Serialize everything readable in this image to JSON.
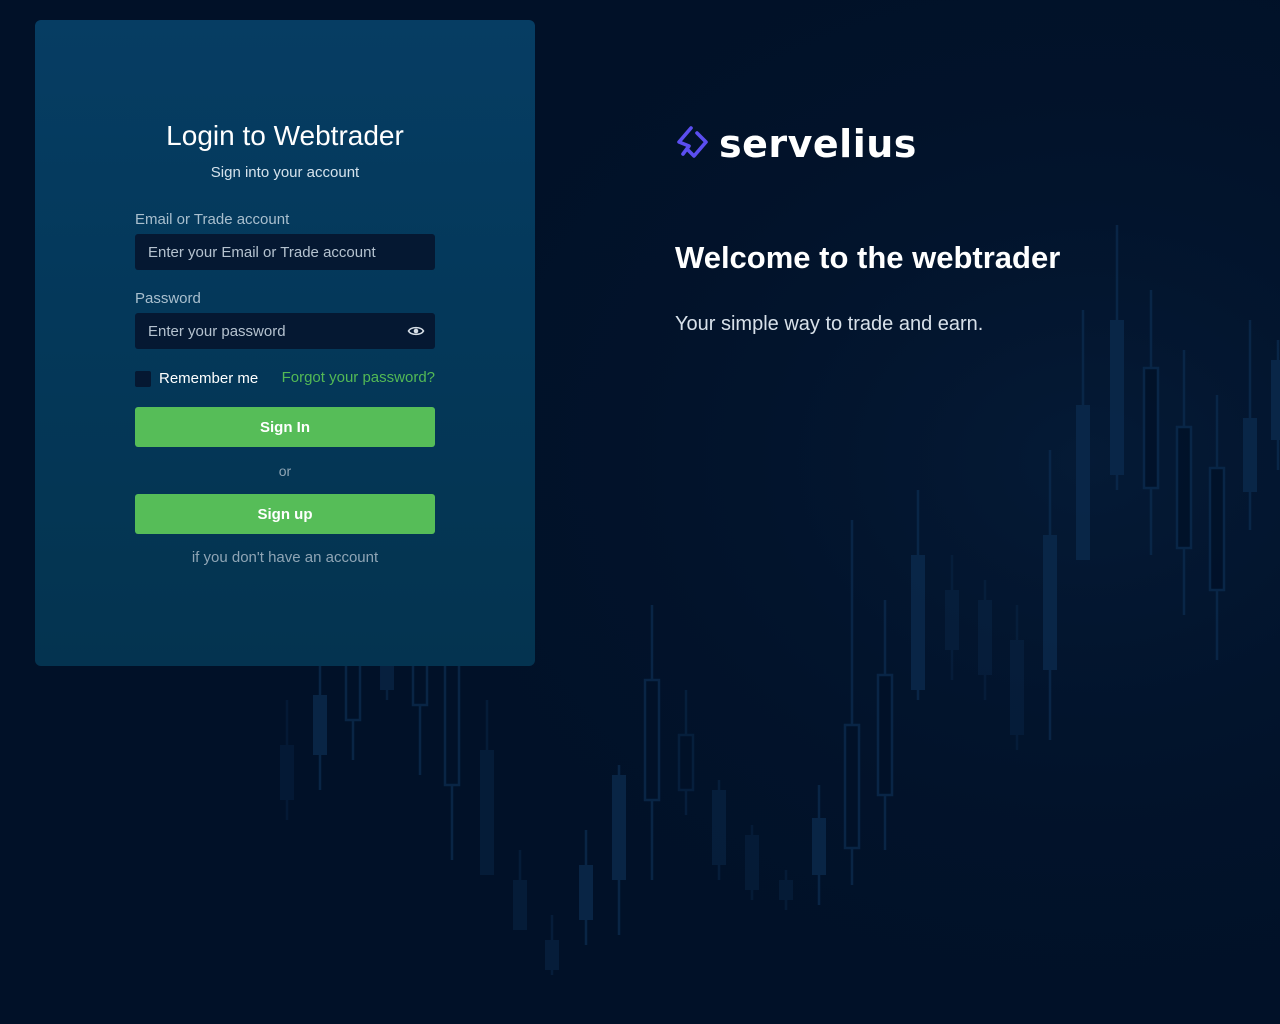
{
  "login": {
    "title": "Login to Webtrader",
    "subtitle": "Sign into your account",
    "email": {
      "label": "Email or Trade account",
      "placeholder": "Enter your Email or Trade account",
      "value": ""
    },
    "password": {
      "label": "Password",
      "placeholder": "Enter your password",
      "value": "",
      "toggle_icon": "eye-icon"
    },
    "remember_label": "Remember me",
    "remember_checked": false,
    "forgot_label": "Forgot your password?",
    "sign_in_label": "Sign In",
    "or_label": "or",
    "sign_up_label": "Sign up",
    "sign_up_hint": "if you don't have an account"
  },
  "brand": {
    "name": "servelius",
    "logo_icon": "servelius-logo-icon"
  },
  "welcome": {
    "title": "Welcome to the webtrader",
    "subtitle": "Your simple way to trade and earn."
  },
  "colors": {
    "background": "#011128",
    "card": "#063d63",
    "input": "#051832",
    "accent_green": "#56bd58",
    "link_green": "#53b955",
    "logo_purple": "#5b4ef0",
    "candle": "#0b2a4d"
  }
}
